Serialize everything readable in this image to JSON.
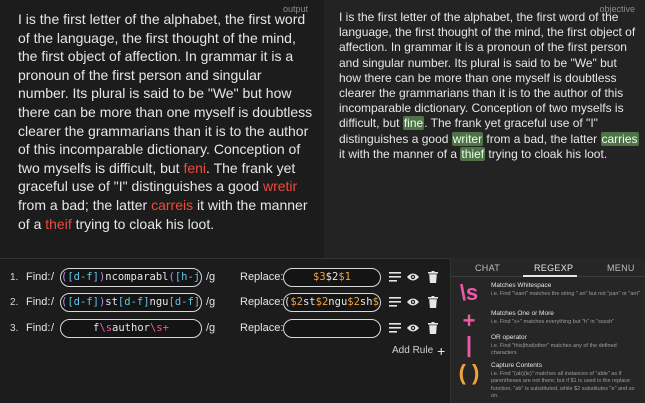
{
  "output": {
    "label": "output",
    "text": [
      {
        "t": "I is the first letter of the alphabet, the first word of the language, the first thought of the mind, the first object of affection. In grammar it is a pronoun of the first person and singular number. Its plural is said to be \"We\" but how there can be more than one myself is doubtless clearer the grammarians than it is to the author of this incomparable dictionary. Conception of two myselfs is difficult, but "
      },
      {
        "t": "feni",
        "err": true
      },
      {
        "t": ". The frank yet graceful use of \"I\" distinguishes a good "
      },
      {
        "t": "wretir",
        "err": true
      },
      {
        "t": " from a bad; the latter "
      },
      {
        "t": "carreis",
        "err": true
      },
      {
        "t": " it with the manner of a "
      },
      {
        "t": "theif",
        "err": true
      },
      {
        "t": " trying to cloak his loot."
      }
    ]
  },
  "objective": {
    "label": "objective",
    "text": [
      {
        "t": "I is the first letter of the alphabet, the first word of the language, the first thought of the mind, the first object of affection. In grammar it is a pronoun of the first person and singular number. Its plural is said to be \"We\" but how there can be more than one myself is doubtless clearer the grammarians than it is to the author of this incomparable dictionary. Conception of two myselfs is difficult, but "
      },
      {
        "t": "fine",
        "hl": true
      },
      {
        "t": ". The frank yet graceful use of \"I\" distinguishes a good "
      },
      {
        "t": "writer",
        "hl": true
      },
      {
        "t": " from a bad, the latter "
      },
      {
        "t": "carries",
        "hl": true
      },
      {
        "t": " it with the manner of a "
      },
      {
        "t": "thief",
        "hl": true
      },
      {
        "t": " trying to cloak his loot."
      }
    ]
  },
  "rules": [
    {
      "number": "1.",
      "find_label": "Find:",
      "slash": "/",
      "flags": "/g",
      "replace_label": "Replace:",
      "find_tokens": [
        {
          "t": "(",
          "c": "c"
        },
        {
          "t": "[d-f]",
          "c": "l"
        },
        {
          "t": ")",
          "c": "c"
        },
        {
          "t": "ncomparabl",
          "c": "w"
        },
        {
          "t": "(",
          "c": "c"
        },
        {
          "t": "[h-j]",
          "c": "l"
        },
        {
          "t": ")",
          "c": "c"
        }
      ],
      "replace_tokens": [
        {
          "t": "$3",
          "c": "o"
        },
        {
          "t": "$2",
          "c": "rp"
        },
        {
          "t": "$1",
          "c": "o"
        }
      ]
    },
    {
      "number": "2.",
      "find_label": "Find:",
      "slash": "/",
      "flags": "/g",
      "replace_label": "Replace:",
      "find_tokens": [
        {
          "t": "(",
          "c": "c"
        },
        {
          "t": "[d-f]",
          "c": "l"
        },
        {
          "t": ")",
          "c": "c"
        },
        {
          "t": "st",
          "c": "w"
        },
        {
          "t": "[d-f]",
          "c": "l"
        },
        {
          "t": "ngu",
          "c": "w"
        },
        {
          "t": "[d-f]",
          "c": "l"
        },
        {
          "t": "sh",
          "c": "w"
        },
        {
          "t": "[d-f]",
          "c": "l"
        },
        {
          "t": "(",
          "c": "c"
        },
        {
          "t": "[h-j]",
          "c": "l"
        },
        {
          "t": ")",
          "c": "c"
        }
      ],
      "replace_tokens": [
        {
          "t": "(",
          "c": "rp"
        },
        {
          "t": "$2",
          "c": "o"
        },
        {
          "t": "st",
          "c": "rp"
        },
        {
          "t": "$2",
          "c": "o"
        },
        {
          "t": "ngu",
          "c": "rp"
        },
        {
          "t": "$2",
          "c": "o"
        },
        {
          "t": "sh",
          "c": "rp"
        },
        {
          "t": "$1",
          "c": "o"
        }
      ]
    },
    {
      "number": "3.",
      "find_label": "Find:",
      "slash": "/",
      "flags": "/g",
      "replace_label": "Replace:",
      "find_tokens": [
        {
          "t": "f",
          "c": "w"
        },
        {
          "t": "\\s",
          "c": "p"
        },
        {
          "t": "author",
          "c": "w"
        },
        {
          "t": "\\s+",
          "c": "p"
        }
      ],
      "replace_tokens": []
    }
  ],
  "add_rule_label": "Add Rule",
  "reference": {
    "tabs": [
      {
        "label": "CHAT",
        "active": false
      },
      {
        "label": "REGEXP",
        "active": true
      },
      {
        "label": "MENU",
        "active": false
      }
    ],
    "items": [
      {
        "symbol": "\\s",
        "color": "#ef5aa7",
        "title": "Matches Whitespace",
        "desc": "i.e. Find \"\\sant\" matches the string \" an\" but not \"pan\" or \"ant\""
      },
      {
        "symbol": "+",
        "color": "#ef5aa7",
        "title": "Matches One or More",
        "desc": "i.e. Find \"s+\" matches everything but \"h\" in \"ssssh\""
      },
      {
        "symbol": "|",
        "color": "#ef5aa7",
        "title": "OR operator",
        "desc": "i.e. Find \"this|that|other\" matches any of the defined characters"
      },
      {
        "symbol": "( )",
        "color": "#f2a43c",
        "title": "Capture Contents",
        "desc": "i.e. Find \"(ab)(le)\" matches all instances of \"able\" as if parentheses are not there; but if $1 is used in the replace function, \"ab\" is substituted, while $2 substitutes \"e\" and so on."
      }
    ]
  }
}
